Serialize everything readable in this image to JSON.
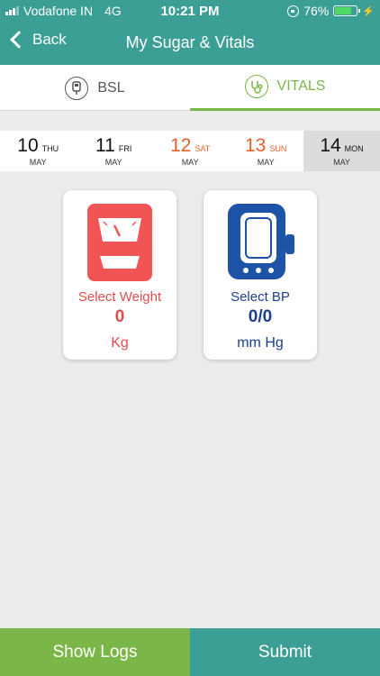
{
  "status_bar": {
    "carrier": "Vodafone IN",
    "network": "4G",
    "time": "10:21 PM",
    "battery": "76%",
    "battery_level": 0.76
  },
  "nav": {
    "back_label": "Back",
    "title": "My Sugar & Vitals"
  },
  "tabs": [
    {
      "label": "BSL",
      "icon": "glucometer-icon"
    },
    {
      "label": "VITALS",
      "icon": "stethoscope-icon",
      "active": true
    }
  ],
  "dates": [
    {
      "num": "10",
      "day": "THU",
      "month": "MAY"
    },
    {
      "num": "11",
      "day": "FRI",
      "month": "MAY"
    },
    {
      "num": "12",
      "day": "SAT",
      "month": "MAY"
    },
    {
      "num": "13",
      "day": "SUN",
      "month": "MAY"
    },
    {
      "num": "14",
      "day": "MON",
      "month": "MAY"
    }
  ],
  "cards": {
    "weight": {
      "label": "Select Weight",
      "value": "0",
      "unit": "Kg",
      "icon": "weighing-scale-icon"
    },
    "bp": {
      "label": "Select BP",
      "value": "0/0",
      "unit": "mm Hg",
      "icon": "bp-monitor-icon"
    }
  },
  "buttons": {
    "logs": "Show Logs",
    "submit": "Submit"
  },
  "colors": {
    "header": "#3c9f95",
    "accent_green": "#7ab648",
    "weekend": "#e5612a",
    "weight_red": "#e14c4c",
    "bp_blue": "#1d3f8e"
  }
}
